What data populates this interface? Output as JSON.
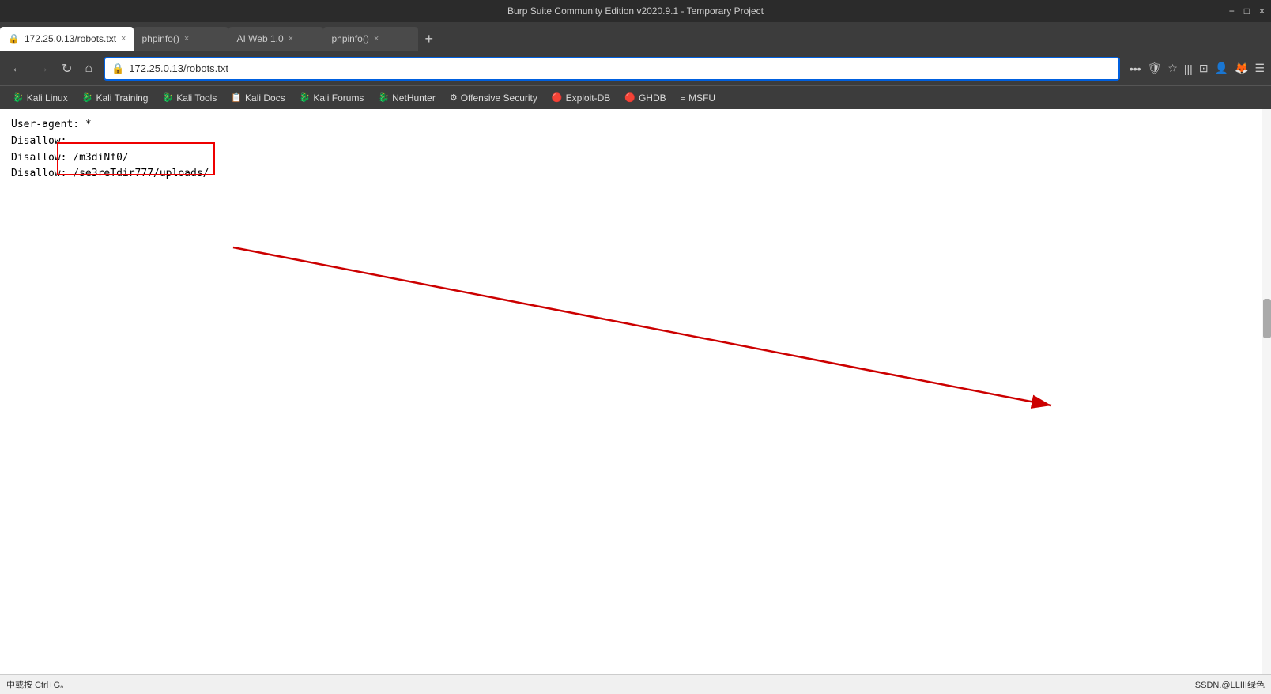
{
  "window": {
    "title": "Burp Suite Community Edition v2020.9.1 - Temporary Project",
    "controls": [
      "−",
      "□",
      "×"
    ]
  },
  "tabs": [
    {
      "id": "tab1",
      "label": "172.25.0.13/robots.txt",
      "active": true,
      "closable": true
    },
    {
      "id": "tab2",
      "label": "phpinfo()",
      "active": false,
      "closable": true
    },
    {
      "id": "tab3",
      "label": "AI Web 1.0",
      "active": false,
      "closable": true
    },
    {
      "id": "tab4",
      "label": "phpinfo()",
      "active": false,
      "closable": true
    }
  ],
  "nav": {
    "back_disabled": false,
    "forward_disabled": true,
    "url": "172.25.0.13/robots.txt",
    "url_prefix": "172.25.0.13",
    "url_suffix": "/robots.txt"
  },
  "bookmarks": [
    {
      "label": "Kali Linux",
      "icon": "🐉"
    },
    {
      "label": "Kali Training",
      "icon": "🐉"
    },
    {
      "label": "Kali Tools",
      "icon": "🐉"
    },
    {
      "label": "Kali Docs",
      "icon": "📋"
    },
    {
      "label": "Kali Forums",
      "icon": "🐉"
    },
    {
      "label": "NetHunter",
      "icon": "🐉"
    },
    {
      "label": "Offensive Security",
      "icon": "⚙"
    },
    {
      "label": "Exploit-DB",
      "icon": "🔴"
    },
    {
      "label": "GHDB",
      "icon": "🔴"
    },
    {
      "label": "MSFU",
      "icon": "≡"
    }
  ],
  "page": {
    "lines": [
      {
        "label": "User-agent:",
        "value": " *"
      },
      {
        "label": "Disallow:",
        "value": ""
      },
      {
        "label": "Disallow:",
        "value": " /m3diNf0/"
      },
      {
        "label": "Disallow:",
        "value": " /se3reTdir777/uploads/"
      }
    ]
  },
  "status": {
    "left": "中或按 Ctrl+G。",
    "right": "SSDN.@LLIII绿色"
  }
}
